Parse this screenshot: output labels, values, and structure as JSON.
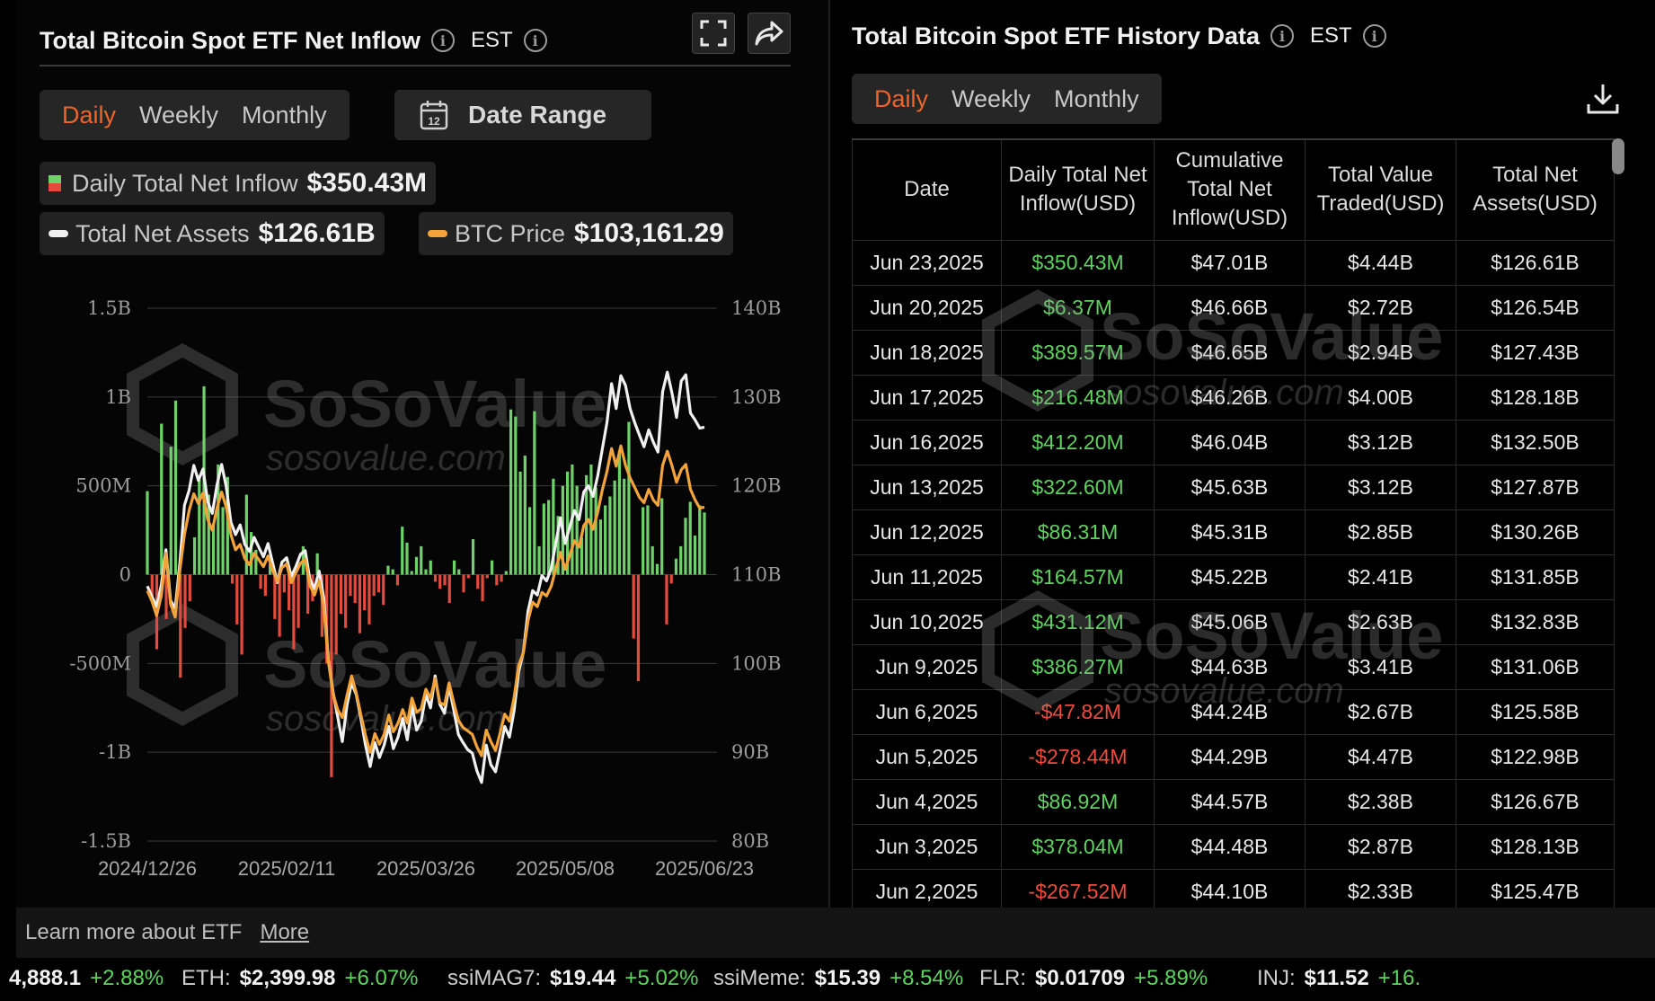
{
  "left": {
    "title": "Total Bitcoin Spot ETF Net Inflow",
    "tz": "EST",
    "tabs": [
      "Daily",
      "Weekly",
      "Monthly"
    ],
    "active_tab": "Daily",
    "date_range_label": "Date Range",
    "calendar_day": "12",
    "legend": {
      "inflow_label": "Daily Total Net Inflow",
      "inflow_value": "$350.43M",
      "assets_label": "Total Net Assets",
      "assets_value": "$126.61B",
      "btc_label": "BTC Price",
      "btc_value": "$103,161.29"
    },
    "watermark": {
      "brand": "SoSoValue",
      "url": "sosovalue.com"
    }
  },
  "chart_data": {
    "type": "bar",
    "x_ticks": [
      "2024/12/26",
      "2025/02/11",
      "2025/03/26",
      "2025/05/08",
      "2025/06/23"
    ],
    "y_left_ticks": [
      "1.5B",
      "1B",
      "500M",
      "0",
      "-500M",
      "-1B",
      "-1.5B"
    ],
    "y_right_ticks": [
      "140B",
      "130B",
      "120B",
      "110B",
      "100B",
      "90B",
      "80B"
    ],
    "ylim_left": [
      -1.5,
      1.5
    ],
    "ylim_right": [
      80,
      140
    ],
    "grid": true,
    "series": [
      {
        "name": "Daily Total Net Inflow",
        "unit": "B USD",
        "color_pos": "#6fd16a",
        "color_neg": "#e54b3c",
        "values": [
          0.47,
          -0.15,
          -0.42,
          0.85,
          -0.25,
          0.72,
          0.98,
          -0.58,
          -0.3,
          -0.15,
          0.21,
          0.56,
          1.06,
          0.45,
          0.28,
          0.62,
          0.38,
          0.55,
          -0.05,
          -0.28,
          -0.45,
          0.45,
          0.24,
          0.14,
          -0.08,
          -0.12,
          0.06,
          -0.25,
          -0.35,
          -0.1,
          -0.2,
          -0.42,
          -0.3,
          0.16,
          -0.22,
          -0.15,
          0.12,
          -0.35,
          -0.5,
          -1.14,
          -0.45,
          -0.22,
          -0.3,
          -0.12,
          -0.16,
          -0.33,
          -0.2,
          -0.28,
          -0.12,
          -0.1,
          -0.17,
          0.05,
          0.03,
          -0.06,
          0.27,
          0.18,
          0.02,
          0.1,
          0.16,
          0.03,
          0.08,
          -0.04,
          -0.08,
          -0.06,
          -0.16,
          0.08,
          0.03,
          -0.1,
          -0.02,
          0.2,
          -0.08,
          -0.15,
          -0.02,
          0.08,
          -0.06,
          -0.04,
          0.02,
          0.93,
          0.89,
          0.58,
          0.67,
          0.38,
          0.92,
          0.16,
          0.4,
          0.42,
          0.54,
          0.33,
          0.5,
          0.58,
          0.62,
          0.5,
          0.21,
          0.56,
          0.62,
          0.49,
          0.31,
          0.39,
          0.44,
          0.53,
          0.7,
          0.54,
          0.86,
          -0.36,
          -0.6,
          0.38,
          0.39,
          0.16,
          0.06,
          0.43,
          -0.28,
          -0.05,
          0.09,
          0.16,
          0.32,
          0.41,
          0.22,
          0.39,
          0.35
        ],
        "price_scale_values": []
      },
      {
        "name": "Total Net Assets",
        "unit": "B USD",
        "color": "#f0f0f0",
        "values": [
          108.7,
          107.5,
          106.4,
          108.8,
          112.8,
          107.1,
          106.2,
          111.3,
          117.8,
          119.5,
          122.3,
          120.6,
          121.9,
          118.2,
          116.9,
          120.1,
          122.4,
          119.9,
          115.9,
          114.5,
          115.6,
          113.4,
          112.6,
          114.2,
          113.1,
          112,
          113.5,
          111.3,
          109.1,
          111.4,
          111.9,
          109.8,
          110.9,
          112.3,
          112.7,
          109.5,
          108.4,
          110.4,
          107.4,
          100.4,
          96.8,
          94,
          91.2,
          95.3,
          97.8,
          96.5,
          93.8,
          90.8,
          88.4,
          91.1,
          89.4,
          90.8,
          92.9,
          90.4,
          91.7,
          93.8,
          91.4,
          95.3,
          92.5,
          93.5,
          96.5,
          95,
          98.6,
          95.4,
          94.4,
          97.4,
          94.8,
          92,
          91.1,
          90.3,
          89.9,
          87.9,
          86.6,
          90.8,
          88.6,
          87.8,
          90.3,
          92.9,
          91.7,
          94.7,
          99.1,
          101.3,
          105.9,
          108.2,
          107.7,
          109.9,
          109.3,
          110.7,
          113.6,
          116.4,
          113.5,
          115.4,
          117.2,
          116.2,
          119.3,
          120,
          118.8,
          121.1,
          124.1,
          127.1,
          131.5,
          128.7,
          132.4,
          131.3,
          128.7,
          127.1,
          125.7,
          124.4,
          126.3,
          124.9,
          123.8,
          130.6,
          132.8,
          130.5,
          127.7,
          131.8,
          132.5,
          128.2,
          127.4,
          126.5,
          126.6
        ],
        "price_scale_values": []
      },
      {
        "name": "BTC Price",
        "unit": "B-scale overlay",
        "color": "#f2a33a",
        "values": [
          108.2,
          107,
          105.4,
          107.6,
          112.4,
          106.7,
          105.2,
          110.5,
          114.5,
          117.2,
          119.1,
          118,
          119.2,
          116.2,
          115,
          117.5,
          119.3,
          117.6,
          114.5,
          112.8,
          113.4,
          111.8,
          111.1,
          112.4,
          111.7,
          110.9,
          112.1,
          110.5,
          109.2,
          110.8,
          111.2,
          109.1,
          110.2,
          111.3,
          111.7,
          108.8,
          107.7,
          109.3,
          106.4,
          100.2,
          96.6,
          94.8,
          93.9,
          96.4,
          98.6,
          96.7,
          94.2,
          91.9,
          90,
          92.1,
          90.9,
          92,
          94.2,
          92.3,
          93.3,
          94.8,
          93.3,
          96.1,
          94.5,
          94.9,
          97.1,
          96.1,
          98.3,
          95.6,
          95.3,
          97.8,
          95.6,
          93.6,
          92.8,
          92.4,
          92,
          90.6,
          89.6,
          92.5,
          91.2,
          90.2,
          92.2,
          94.3,
          93.5,
          96.2,
          99.8,
          101.2,
          104.8,
          106.9,
          106.4,
          108,
          107.6,
          108.7,
          110.7,
          112.5,
          110.6,
          112.2,
          113.8,
          113.1,
          115.5,
          116.2,
          115.1,
          117,
          119.5,
          121.6,
          124.2,
          122.2,
          124.5,
          122.3,
          120.9,
          119.8,
          118.7,
          118.1,
          119.6,
          118.4,
          117.8,
          122.3,
          123.9,
          122.3,
          120.4,
          121.8,
          122.4,
          119.6,
          118.4,
          117.5,
          117.6
        ],
        "price_scale_values": []
      }
    ]
  },
  "right": {
    "title": "Total Bitcoin Spot ETF History Data",
    "tz": "EST",
    "tabs": [
      "Daily",
      "Weekly",
      "Monthly"
    ],
    "active_tab": "Daily",
    "headers": [
      "Date",
      "Daily Total Net Inflow(USD)",
      "Cumulative Total Net Inflow(USD)",
      "Total Value Traded(USD)",
      "Total Net Assets(USD)"
    ],
    "rows": [
      {
        "date": "Jun 23,2025",
        "inflow": "$350.43M",
        "cum": "$47.01B",
        "traded": "$4.44B",
        "assets": "$126.61B",
        "sign": "pos"
      },
      {
        "date": "Jun 20,2025",
        "inflow": "$6.37M",
        "cum": "$46.66B",
        "traded": "$2.72B",
        "assets": "$126.54B",
        "sign": "pos"
      },
      {
        "date": "Jun 18,2025",
        "inflow": "$389.57M",
        "cum": "$46.65B",
        "traded": "$2.94B",
        "assets": "$127.43B",
        "sign": "pos"
      },
      {
        "date": "Jun 17,2025",
        "inflow": "$216.48M",
        "cum": "$46.26B",
        "traded": "$4.00B",
        "assets": "$128.18B",
        "sign": "pos"
      },
      {
        "date": "Jun 16,2025",
        "inflow": "$412.20M",
        "cum": "$46.04B",
        "traded": "$3.12B",
        "assets": "$132.50B",
        "sign": "pos"
      },
      {
        "date": "Jun 13,2025",
        "inflow": "$322.60M",
        "cum": "$45.63B",
        "traded": "$3.12B",
        "assets": "$127.87B",
        "sign": "pos"
      },
      {
        "date": "Jun 12,2025",
        "inflow": "$86.31M",
        "cum": "$45.31B",
        "traded": "$2.85B",
        "assets": "$130.26B",
        "sign": "pos"
      },
      {
        "date": "Jun 11,2025",
        "inflow": "$164.57M",
        "cum": "$45.22B",
        "traded": "$2.41B",
        "assets": "$131.85B",
        "sign": "pos"
      },
      {
        "date": "Jun 10,2025",
        "inflow": "$431.12M",
        "cum": "$45.06B",
        "traded": "$2.63B",
        "assets": "$132.83B",
        "sign": "pos"
      },
      {
        "date": "Jun 9,2025",
        "inflow": "$386.27M",
        "cum": "$44.63B",
        "traded": "$3.41B",
        "assets": "$131.06B",
        "sign": "pos"
      },
      {
        "date": "Jun 6,2025",
        "inflow": "-$47.82M",
        "cum": "$44.24B",
        "traded": "$2.67B",
        "assets": "$125.58B",
        "sign": "neg"
      },
      {
        "date": "Jun 5,2025",
        "inflow": "-$278.44M",
        "cum": "$44.29B",
        "traded": "$4.47B",
        "assets": "$122.98B",
        "sign": "neg"
      },
      {
        "date": "Jun 4,2025",
        "inflow": "$86.92M",
        "cum": "$44.57B",
        "traded": "$2.38B",
        "assets": "$126.67B",
        "sign": "pos"
      },
      {
        "date": "Jun 3,2025",
        "inflow": "$378.04M",
        "cum": "$44.48B",
        "traded": "$2.87B",
        "assets": "$128.13B",
        "sign": "pos"
      },
      {
        "date": "Jun 2,2025",
        "inflow": "-$267.52M",
        "cum": "$44.10B",
        "traded": "$2.33B",
        "assets": "$125.47B",
        "sign": "neg"
      }
    ]
  },
  "footer": {
    "learn_text": "Learn more about ETF",
    "more_link": "More"
  },
  "ticker": [
    {
      "sym": "",
      "price": "4,888.1",
      "chg": "+2.88%"
    },
    {
      "sym": "ETH:",
      "price": "$2,399.98",
      "chg": "+6.07%"
    },
    {
      "sym": "ssiMAG7:",
      "price": "$19.44",
      "chg": "+5.02%"
    },
    {
      "sym": "ssiMeme:",
      "price": "$15.39",
      "chg": "+8.54%"
    },
    {
      "sym": "FLR:",
      "price": "$0.01709",
      "chg": "+5.89%"
    },
    {
      "sym": "INJ:",
      "price": "$11.52",
      "chg": "+16."
    }
  ],
  "colors": {
    "accent": "#f0642b",
    "pos": "#5fd35f",
    "neg": "#ef4b3f"
  }
}
